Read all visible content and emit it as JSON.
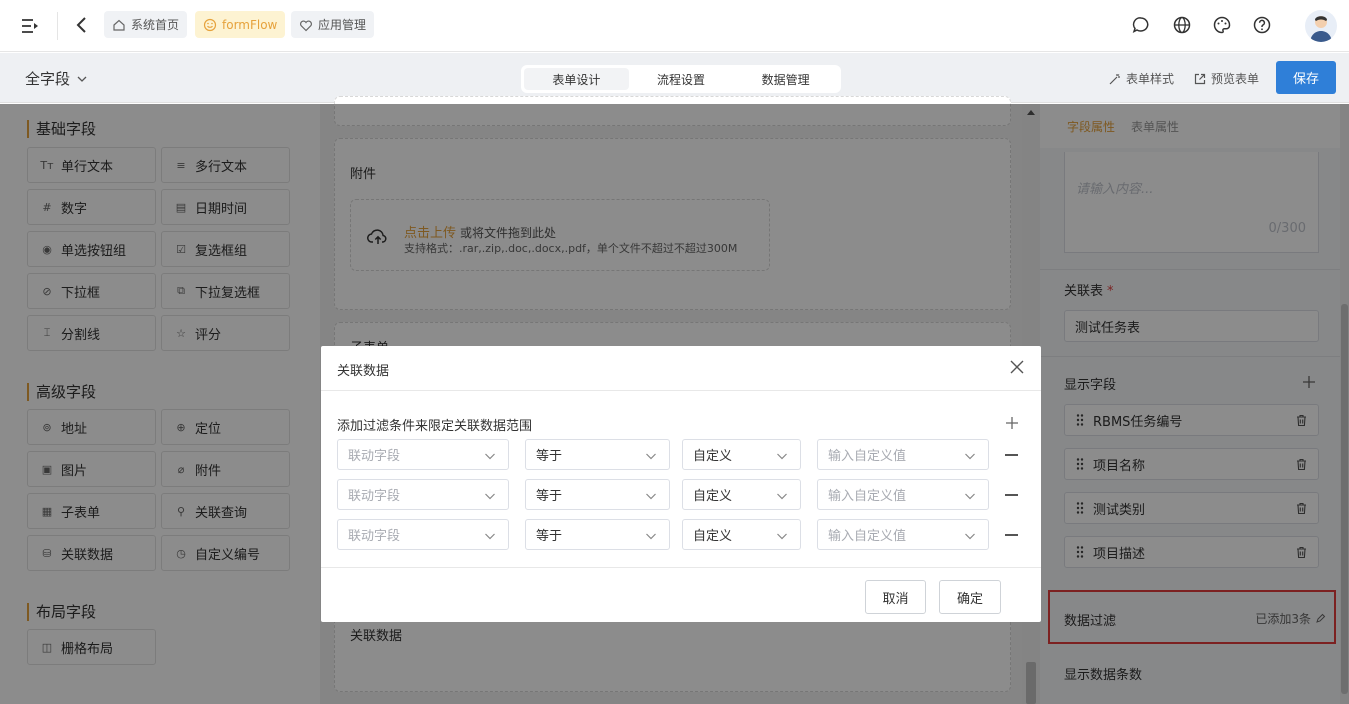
{
  "topbar": {
    "tags": [
      {
        "label": "系统首页",
        "icon": "home-icon"
      },
      {
        "label": "formFlow",
        "icon": "smile-icon",
        "active": true
      },
      {
        "label": "应用管理",
        "icon": "gift-icon"
      }
    ],
    "icons": [
      "chat-icon",
      "globe-icon",
      "palette-icon",
      "help-icon"
    ]
  },
  "subbar": {
    "field_scope": "全字段",
    "segments": [
      "表单设计",
      "流程设置",
      "数据管理"
    ],
    "active_segment": 0,
    "form_style": "表单样式",
    "preview": "预览表单",
    "save": "保存"
  },
  "left": {
    "groups": [
      {
        "title": "基础字段",
        "items": [
          {
            "label": "单行文本",
            "icon": "Tт"
          },
          {
            "label": "多行文本",
            "icon": "≡"
          },
          {
            "label": "数字",
            "icon": "#"
          },
          {
            "label": "日期时间",
            "icon": "▤"
          },
          {
            "label": "单选按钮组",
            "icon": "◉"
          },
          {
            "label": "复选框组",
            "icon": "☑"
          },
          {
            "label": "下拉框",
            "icon": "⊘"
          },
          {
            "label": "下拉复选框",
            "icon": "⧉"
          },
          {
            "label": "分割线",
            "icon": "⌶"
          },
          {
            "label": "评分",
            "icon": "☆"
          }
        ]
      },
      {
        "title": "高级字段",
        "items": [
          {
            "label": "地址",
            "icon": "⊚"
          },
          {
            "label": "定位",
            "icon": "⊕"
          },
          {
            "label": "图片",
            "icon": "▣"
          },
          {
            "label": "附件",
            "icon": "⌀"
          },
          {
            "label": "子表单",
            "icon": "▦"
          },
          {
            "label": "关联查询",
            "icon": "⚲"
          },
          {
            "label": "关联数据",
            "icon": "⛁"
          },
          {
            "label": "自定义编号",
            "icon": "◷"
          }
        ]
      },
      {
        "title": "布局字段",
        "items": [
          {
            "label": "栅格布局",
            "icon": "◫"
          }
        ]
      }
    ]
  },
  "canvas": {
    "attachment_title": "附件",
    "upload_link": "点击上传",
    "upload_hint": "或将文件拖到此处",
    "upload_formats": "支持格式：.rar,.zip,.doc,.docx,.pdf，单个文件不超过不超过300M",
    "subform_title": "子表单",
    "related_title": "关联数据"
  },
  "right": {
    "tabs": [
      "字段属性",
      "表单属性"
    ],
    "textarea_placeholder": "请输入内容...",
    "textarea_count": "0/300",
    "related_table_label": "关联表",
    "related_table_value": "测试任务表",
    "display_fields_label": "显示字段",
    "display_fields": [
      "RBMS任务编号",
      "项目名称",
      "测试类别",
      "项目描述"
    ],
    "data_filter_label": "数据过滤",
    "data_filter_value": "已添加3条",
    "display_count_label": "显示数据条数"
  },
  "modal": {
    "title": "关联数据",
    "subtitle": "添加过滤条件来限定关联数据范围",
    "rows": [
      {
        "field": "联动字段",
        "op": "等于",
        "type": "自定义",
        "value": "输入自定义值"
      },
      {
        "field": "联动字段",
        "op": "等于",
        "type": "自定义",
        "value": "输入自定义值"
      },
      {
        "field": "联动字段",
        "op": "等于",
        "type": "自定义",
        "value": "输入自定义值"
      }
    ],
    "cancel": "取消",
    "confirm": "确定"
  },
  "colors": {
    "accent": "#e6a23c",
    "primary": "#2f7fd8",
    "highlight": "#e23d3d"
  }
}
